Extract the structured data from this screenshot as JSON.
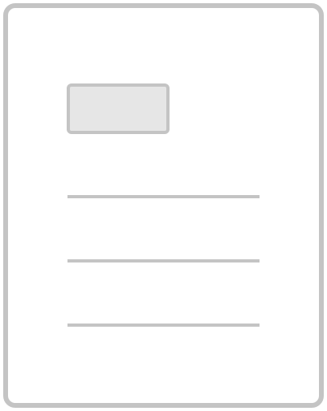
{
  "document_icon": {
    "name": "document-icon",
    "colors": {
      "outline": "#c4c4c4",
      "page_fill": "#ffffff",
      "block_fill": "#e6e6e6",
      "line": "#c4c4c4"
    },
    "text_line_count": 3
  }
}
